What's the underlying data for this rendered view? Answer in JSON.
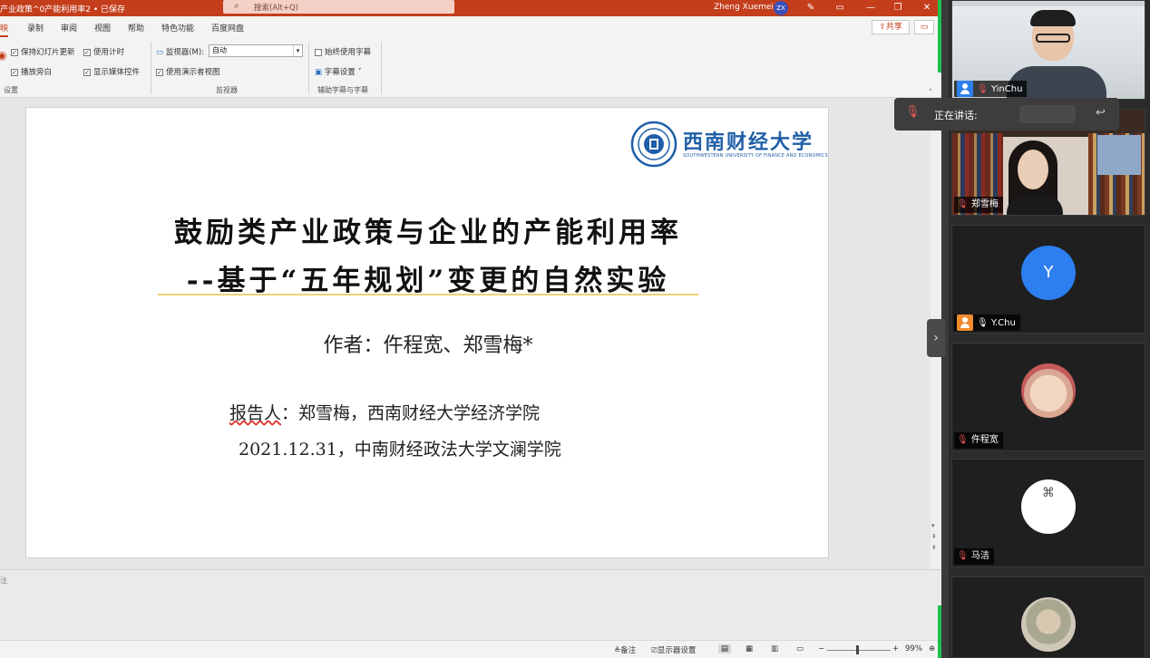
{
  "ppt": {
    "doc_title": "产业政策^0产能利用率2 • 已保存",
    "search_placeholder": "搜索(Alt+Q)",
    "user_name": "Zheng Xuemei",
    "user_initials": "ZX",
    "tabs": [
      "映",
      "录制",
      "审阅",
      "视图",
      "帮助",
      "特色功能",
      "百度网盘"
    ],
    "share_label": "共享",
    "ribbon": {
      "keep_updated": "保持幻灯片更新",
      "use_timer": "使用计时",
      "play_narration": "播放旁白",
      "show_media_controls": "显示媒体控件",
      "group_setup": "设置",
      "monitor_label": "监视器(M):",
      "monitor_value": "自动",
      "presenter_view": "使用演示者视图",
      "group_monitor": "监视器",
      "always_subtitles": "始终使用字幕",
      "subtitle_settings": "字幕设置",
      "group_subtitles": "辅助字幕与字幕"
    },
    "slide": {
      "logo_name": "西南财经大学",
      "logo_en": "SOUTHWESTERN UNIVERSITY OF FINANCE AND ECONOMICS",
      "title_line1": "鼓励类产业政策与企业的产能利用率",
      "title_line2": "--基于“五年规划”变更的自然实验",
      "authors": "作者：仵程宽、郑雪梅*",
      "reporter_label": "报告人",
      "reporter_rest": "：郑雪梅，西南财经大学经济学院",
      "date_venue": "2021.12.31，中南财经政法大学文澜学院"
    },
    "notes_hint": "注",
    "status": {
      "notes": "备注",
      "display_settings": "显示器设置",
      "zoom": "99%"
    },
    "colors": {
      "accent": "#c43e1c",
      "logo_blue": "#1f5fa8"
    }
  },
  "meeting": {
    "speaking_label": "正在讲话:",
    "participants": [
      {
        "name": "YinChu",
        "icon": "user-icon-blue"
      },
      {
        "name": "郑雪梅",
        "icon": "mic-muted-icon"
      },
      {
        "name": "Y.Chu",
        "icon": "user-icon-orange",
        "avatar_letter": "Y"
      },
      {
        "name": "仵程宽",
        "icon": "mic-muted-icon"
      },
      {
        "name": "马洁",
        "icon": "mic-muted-icon"
      },
      {
        "name": "",
        "icon": ""
      }
    ]
  }
}
